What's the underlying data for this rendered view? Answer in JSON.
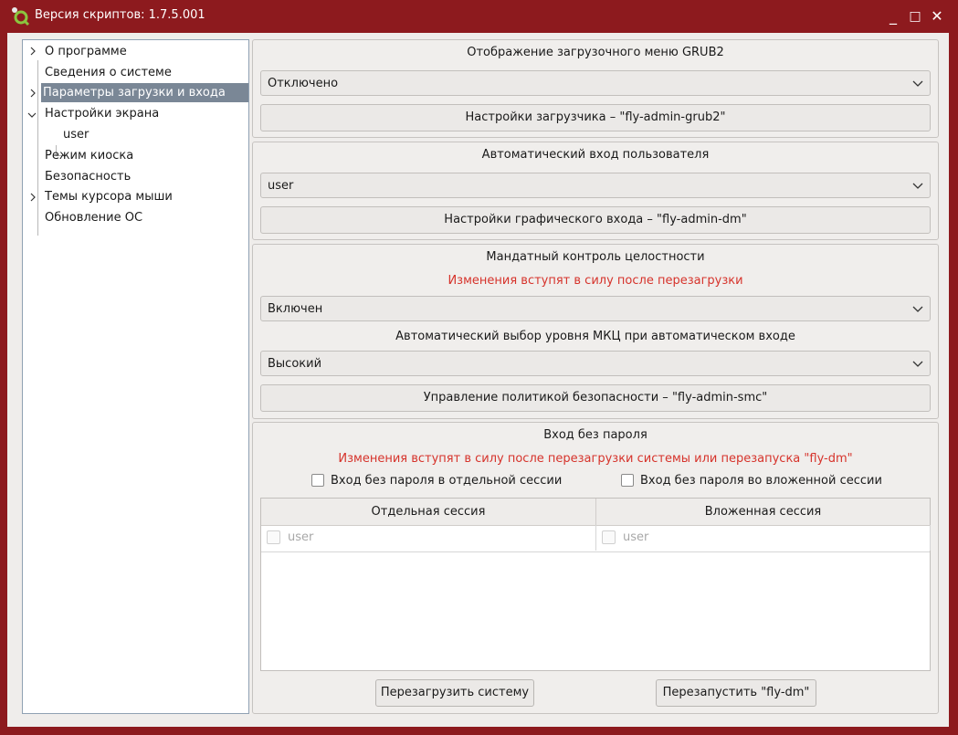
{
  "window": {
    "title": "Версия скриптов: 1.7.5.001",
    "controls": {
      "minimize": "_",
      "maximize": "□",
      "close": "✕"
    },
    "frame_color": "#8d1a1e"
  },
  "sidebar": {
    "items": [
      {
        "label": "О программе",
        "icon": "chevron-right-icon"
      },
      {
        "label": "Сведения о системе"
      },
      {
        "label": "Параметры загрузки и входа",
        "icon": "chevron-right-icon",
        "selected": true
      },
      {
        "label": "Настройки экрана",
        "icon": "chevron-down-icon"
      },
      {
        "label": "user"
      },
      {
        "label": "Режим киоска"
      },
      {
        "label": "Безопасность"
      },
      {
        "label": "Темы курсора мыши",
        "icon": "chevron-right-icon"
      },
      {
        "label": "Обновление ОС"
      }
    ]
  },
  "grub": {
    "title": "Отображение загрузочного меню GRUB2",
    "combo_value": "Отключено",
    "button": "Настройки загрузчика – \"fly-admin-grub2\""
  },
  "autologin": {
    "title": "Автоматический вход пользователя",
    "combo_value": "user",
    "button": "Настройки графического входа – \"fly-admin-dm\""
  },
  "mic": {
    "title": "Мандатный контроль целостности",
    "warning": "Изменения вступят в силу после перезагрузки",
    "combo_value": "Включен",
    "level_title": "Автоматический выбор уровня МКЦ при автоматическом входе",
    "level_value": "Высокий",
    "button": "Управление политикой безопасности – \"fly-admin-smc\""
  },
  "nopass": {
    "title": "Вход без пароля",
    "warning": "Изменения вступят в силу после перезагрузки системы или перезапуска \"fly-dm\"",
    "check_separate": "Вход без пароля в отдельной сессии",
    "check_nested": "Вход без пароля во вложенной сессии",
    "columns": [
      "Отдельная сессия",
      "Вложенная сессия"
    ],
    "rows": [
      [
        "user",
        "user"
      ]
    ],
    "reboot_button": "Перезагрузить систему",
    "restart_button": "Перезапустить \"fly-dm\""
  },
  "colors": {
    "warning": "#d6332b",
    "selection": "#7a8796",
    "accent_icon": "#8bc53f"
  }
}
